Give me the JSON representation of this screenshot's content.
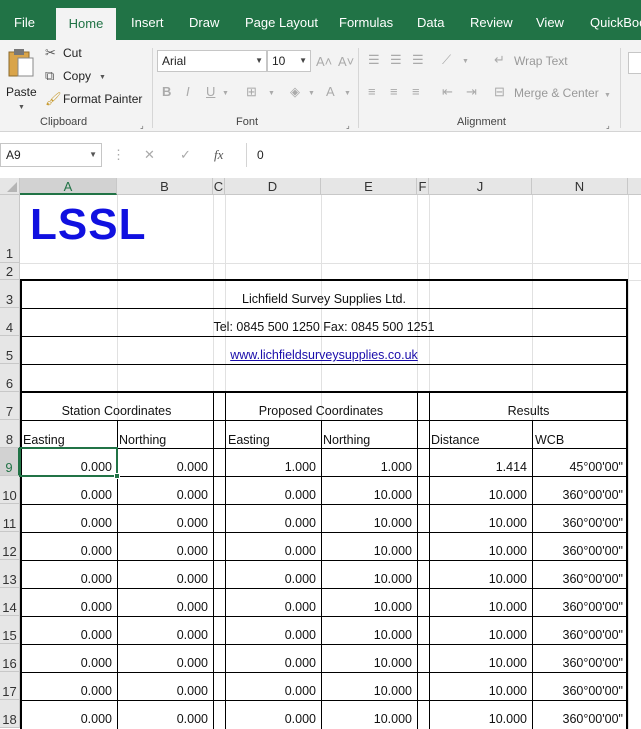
{
  "ribbon": {
    "tabs": [
      "File",
      "Home",
      "Insert",
      "Draw",
      "Page Layout",
      "Formulas",
      "Data",
      "Review",
      "View",
      "QuickBoo"
    ],
    "active_tab": "Home",
    "clipboard": {
      "paste": "Paste",
      "cut": "Cut",
      "copy": "Copy",
      "format_painter": "Format Painter",
      "group_label": "Clipboard"
    },
    "font": {
      "name": "Arial",
      "size": "10",
      "bold": "B",
      "italic": "I",
      "underline": "U",
      "group_label": "Font"
    },
    "alignment": {
      "wrap_text": "Wrap Text",
      "merge_center": "Merge & Center",
      "group_label": "Alignment"
    }
  },
  "formula_bar": {
    "name_box": "A9",
    "fx": "fx",
    "value": "0"
  },
  "columns": [
    "A",
    "B",
    "C",
    "D",
    "E",
    "F",
    "J",
    "N"
  ],
  "rows": [
    "1",
    "2",
    "3",
    "4",
    "5",
    "6",
    "7",
    "8",
    "9",
    "10",
    "11",
    "12",
    "13",
    "14",
    "15",
    "16",
    "17",
    "18"
  ],
  "sheet": {
    "logo": "LSSL",
    "company": "Lichfield Survey Supplies Ltd.",
    "phones": "Tel: 0845 500 1250  Fax: 0845 500 1251",
    "website": "www.lichfieldsurveysupplies.co.uk",
    "section_station": "Station Coordinates",
    "section_proposed": "Proposed Coordinates",
    "section_results": "Results",
    "hdr_easting": "Easting",
    "hdr_northing": "Northing",
    "hdr_easting2": "Easting",
    "hdr_northing2": "Northing",
    "hdr_distance": "Distance",
    "hdr_wcb": "WCB",
    "data_rows": [
      [
        "0.000",
        "0.000",
        "1.000",
        "1.000",
        "1.414",
        "45°00'00\""
      ],
      [
        "0.000",
        "0.000",
        "0.000",
        "10.000",
        "10.000",
        "360°00'00\""
      ],
      [
        "0.000",
        "0.000",
        "0.000",
        "10.000",
        "10.000",
        "360°00'00\""
      ],
      [
        "0.000",
        "0.000",
        "0.000",
        "10.000",
        "10.000",
        "360°00'00\""
      ],
      [
        "0.000",
        "0.000",
        "0.000",
        "10.000",
        "10.000",
        "360°00'00\""
      ],
      [
        "0.000",
        "0.000",
        "0.000",
        "10.000",
        "10.000",
        "360°00'00\""
      ],
      [
        "0.000",
        "0.000",
        "0.000",
        "10.000",
        "10.000",
        "360°00'00\""
      ],
      [
        "0.000",
        "0.000",
        "0.000",
        "10.000",
        "10.000",
        "360°00'00\""
      ],
      [
        "0.000",
        "0.000",
        "0.000",
        "10.000",
        "10.000",
        "360°00'00\""
      ],
      [
        "0.000",
        "0.000",
        "0.000",
        "10.000",
        "10.000",
        "360°00'00\""
      ]
    ]
  },
  "colors": {
    "excel_green": "#217346",
    "logo_blue": "#1010e0",
    "link_blue": "#1a0dab"
  }
}
